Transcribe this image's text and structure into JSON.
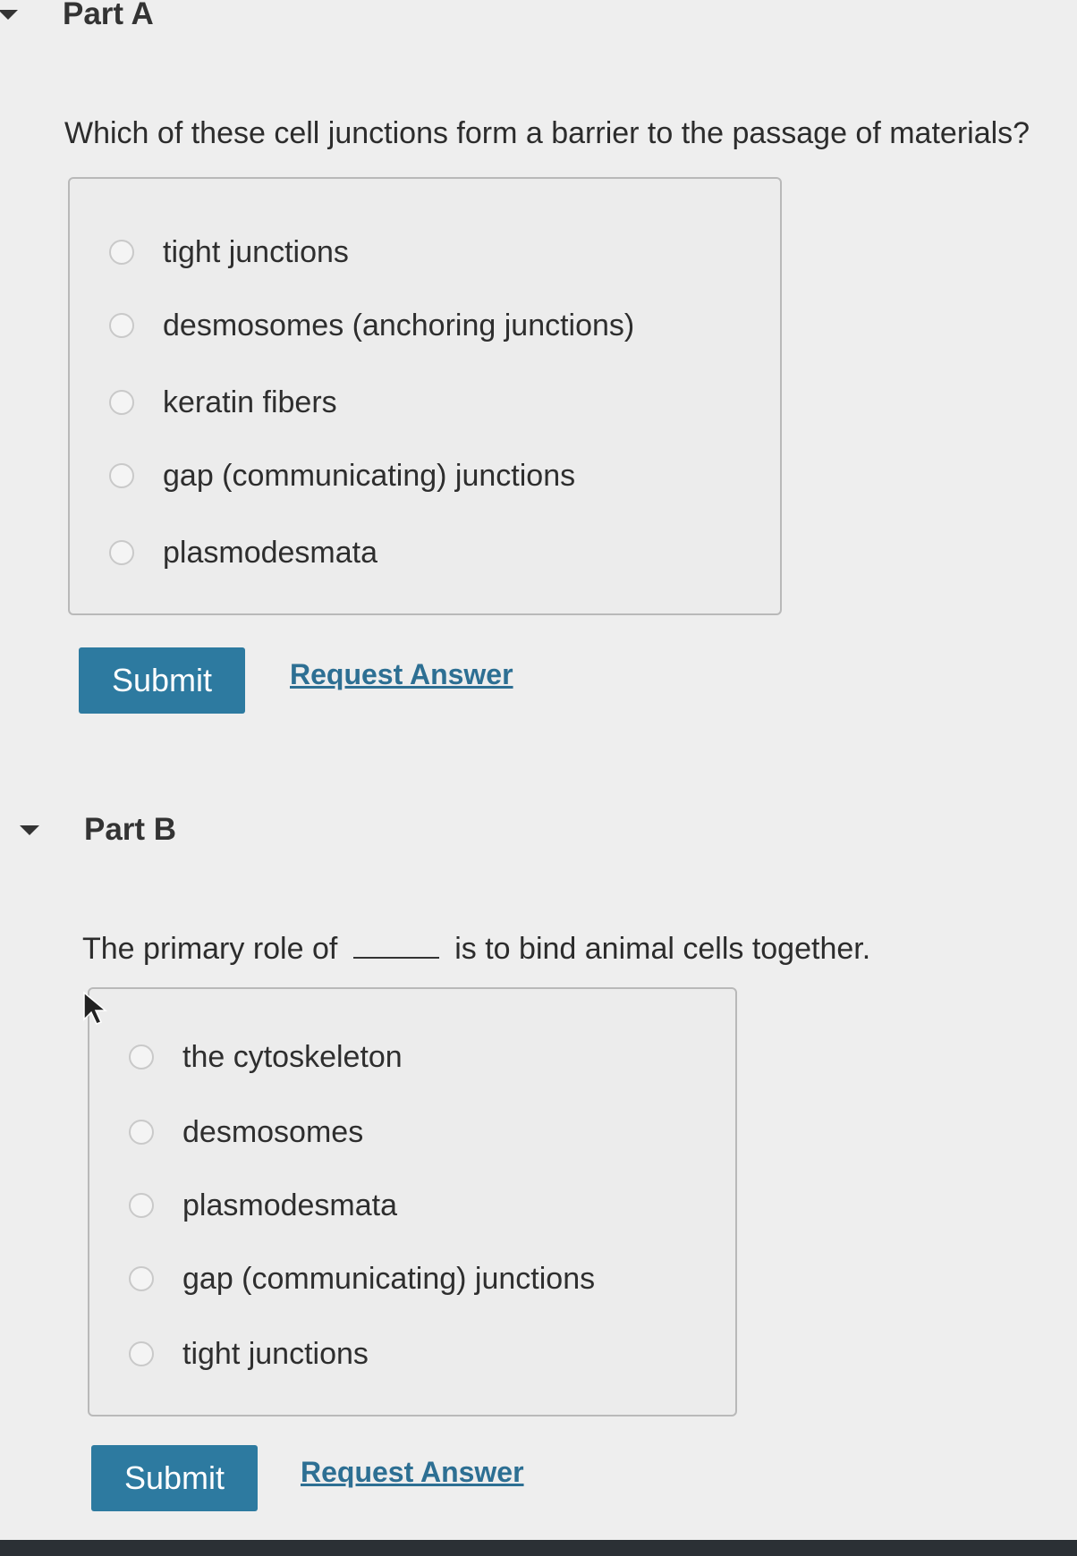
{
  "part_a": {
    "title": "Part A",
    "question": "Which of these cell junctions form a barrier to the passage of materials?",
    "options": [
      "tight junctions",
      "desmosomes (anchoring junctions)",
      "keratin fibers",
      "gap (communicating) junctions",
      "plasmodesmata"
    ],
    "submit_label": "Submit",
    "request_answer_label": "Request Answer"
  },
  "part_b": {
    "title": "Part B",
    "question_before": "The primary role of",
    "question_after": "is to bind animal cells together.",
    "options": [
      "the cytoskeleton",
      "desmosomes",
      "plasmodesmata",
      "gap (communicating) junctions",
      "tight junctions"
    ],
    "submit_label": "Submit",
    "request_answer_label": "Request Answer"
  },
  "colors": {
    "submit_button": "#2d7aa0",
    "link": "#2d6f93",
    "background": "#eeeeee"
  },
  "icons": {
    "collapse": "caret-down-icon",
    "radio": "radio-unchecked-icon",
    "pointer": "mouse-cursor-icon"
  }
}
